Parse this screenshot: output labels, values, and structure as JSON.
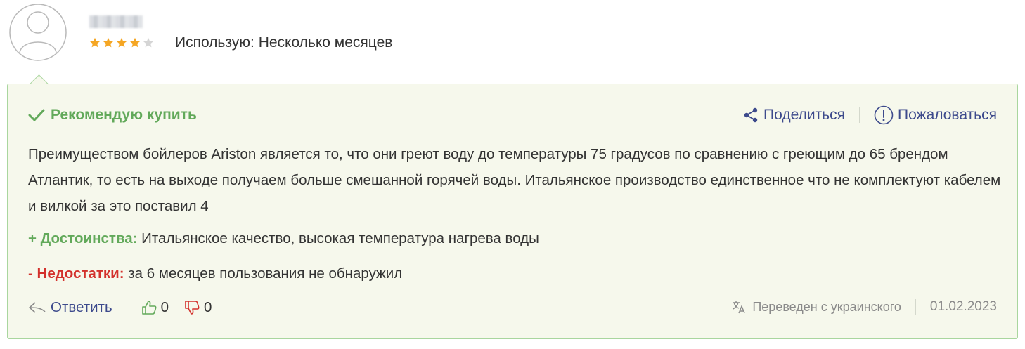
{
  "user": {
    "rating": 4,
    "rating_max": 5,
    "usage_label": "Использую: Несколько месяцев"
  },
  "review": {
    "recommend_label": "Рекомендую купить",
    "share_label": "Поделиться",
    "report_label": "Пожаловаться",
    "text": "Преимуществом бойлеров Ariston является то, что они греют воду до температуры 75 градусов по сравнению с греющим до 65 брендом Атлантик, то есть на выходе получаем больше смешанной горячей воды. Итальянское производство единственное что не комплектуют кабелем и вилкой за это поставил 4",
    "pros_label": "+ Достоинства:",
    "pros_text": "Итальянское качество, высокая температура нагрева воды",
    "cons_label": "- Недостатки:",
    "cons_text": "за 6 месяцев пользования не обнаружил",
    "reply_label": "Ответить",
    "likes": "0",
    "dislikes": "0",
    "translated_label": "Переведен с украинского",
    "date": "01.02.2023"
  },
  "colors": {
    "accent_green": "#62a95a",
    "accent_red": "#d3312c",
    "link_blue": "#3d4a8c",
    "star_gold": "#f5a623",
    "star_empty": "#d5d5d5",
    "card_bg": "#f6f8ec",
    "card_border": "#a9d69e"
  }
}
